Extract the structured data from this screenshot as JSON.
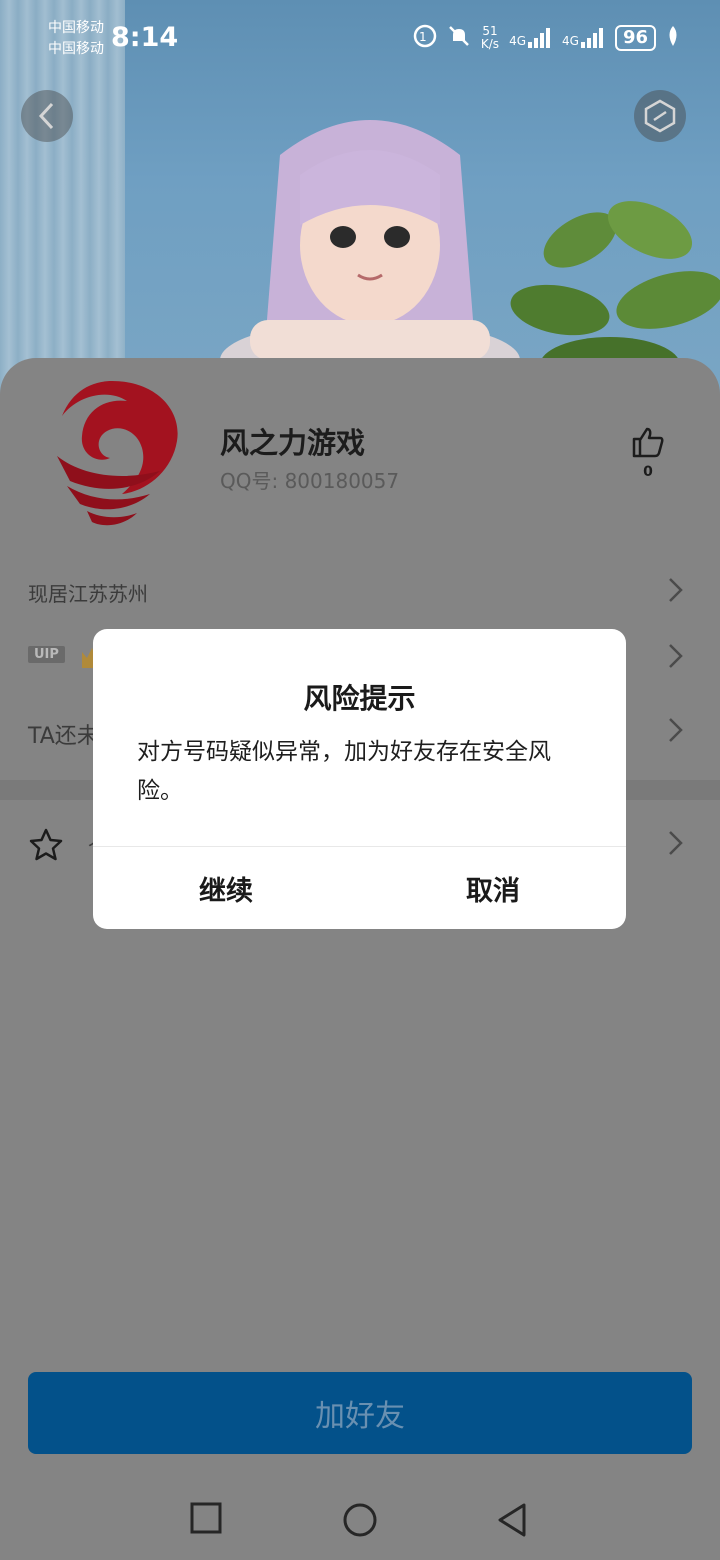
{
  "status_bar": {
    "carrier_1": "中国移动",
    "carrier_2": "中国移动",
    "time": "8:14",
    "net_speed_top": "51",
    "net_speed_bottom": "K/s",
    "signal_1_label": "4G",
    "signal_2_label": "4G",
    "battery": "96"
  },
  "profile": {
    "name": "风之力游戏",
    "qq_label": "QQ号: 800180057",
    "like_count": "0",
    "location": "现居江苏苏州",
    "vip_badge": "UIP",
    "hidden_row_prefix": "TA还未",
    "fav_row_prefix": "个"
  },
  "dialog": {
    "title": "风险提示",
    "message": "对方号码疑似异常，加为好友存在安全风险。",
    "continue_label": "继续",
    "cancel_label": "取消"
  },
  "add_friend_button": "加好友",
  "colors": {
    "primary_button": "#03518a",
    "overlay_card": "#848484",
    "dialog_bg": "#ffffff",
    "logo_red": "#a3121f"
  }
}
